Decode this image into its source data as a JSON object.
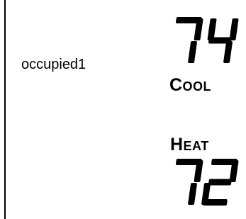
{
  "thermostat": {
    "schedule_name": "occupied1",
    "cool": {
      "setpoint": "74",
      "label": "Cool"
    },
    "heat": {
      "setpoint": "72",
      "label": "Heat"
    },
    "colors": {
      "background": "#ffffff",
      "foreground": "#000000"
    }
  }
}
